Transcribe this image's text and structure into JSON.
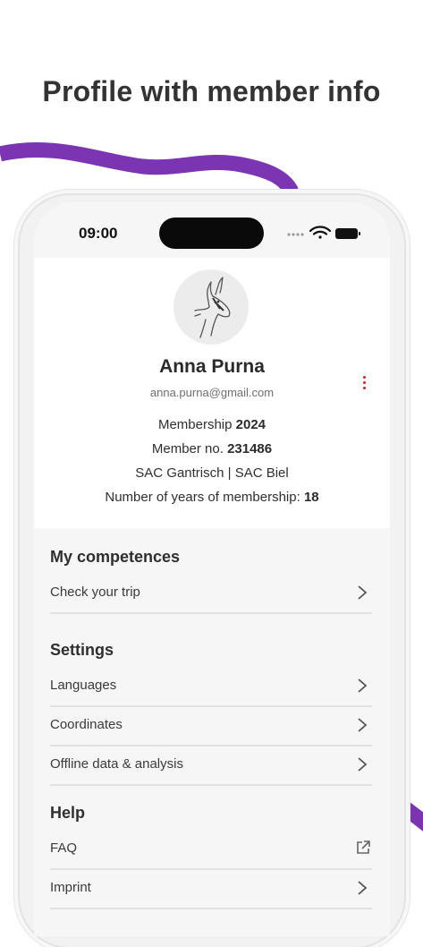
{
  "headline": "Profile with member info",
  "colors": {
    "accent_wave": "#7b35b3",
    "menu_dots": "#d0202e"
  },
  "status_bar": {
    "time": "09:00"
  },
  "profile": {
    "name": "Anna Purna",
    "email": "anna.purna@gmail.com",
    "membership_label": "Membership ",
    "membership_value": "2024",
    "member_no_label": "Member no. ",
    "member_no_value": "231486",
    "sections": "SAC Gantrisch | SAC Biel",
    "years_label": "Number of years of membership: ",
    "years_value": "18"
  },
  "competences": {
    "title": "My competences",
    "items": [
      {
        "label": "Check your trip",
        "icon": "chevron-right-icon"
      }
    ]
  },
  "settings": {
    "title": "Settings",
    "items": [
      {
        "label": "Languages",
        "icon": "chevron-right-icon"
      },
      {
        "label": "Coordinates",
        "icon": "chevron-right-icon"
      },
      {
        "label": "Offline data & analysis",
        "icon": "chevron-right-icon"
      }
    ]
  },
  "help": {
    "title": "Help",
    "items": [
      {
        "label": "FAQ",
        "icon": "external-link-icon"
      },
      {
        "label": "Imprint",
        "icon": "chevron-right-icon"
      }
    ]
  }
}
